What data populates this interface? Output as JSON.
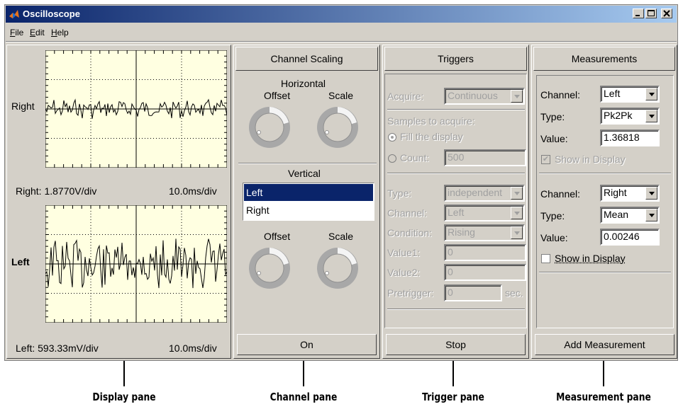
{
  "window": {
    "title": "Oscilloscope"
  },
  "menu": [
    "File",
    "Edit",
    "Help"
  ],
  "display": {
    "right": {
      "name": "Right",
      "vdiv": "Right: 1.8770V/div",
      "tdiv": "10.0ms/div"
    },
    "left": {
      "name": "Left",
      "vdiv": "Left: 593.33mV/div",
      "tdiv": "10.0ms/div"
    }
  },
  "channel": {
    "header": "Channel Scaling",
    "horizontal": "Horizontal",
    "offset": "Offset",
    "scale": "Scale",
    "vertical": "Vertical",
    "list": [
      "Left",
      "Right"
    ],
    "selected": "Left",
    "button": "On"
  },
  "triggers": {
    "header": "Triggers",
    "acquire_label": "Acquire:",
    "acquire_value": "Continuous",
    "samples_label": "Samples to acquire:",
    "fill_label": "Fill the display",
    "count_label": "Count:",
    "count_value": "500",
    "type_label": "Type:",
    "type_value": "independent",
    "channel_label": "Channel:",
    "channel_value": "Left",
    "condition_label": "Condition:",
    "condition_value": "Rising",
    "value1_label": "Value1:",
    "value1": "0",
    "value2_label": "Value2:",
    "value2": "0",
    "pretrigger_label": "Pretrigger:",
    "pretrigger": "0",
    "sec": "sec.",
    "button": "Stop"
  },
  "measurements": {
    "header": "Measurements",
    "channel_label": "Channel:",
    "type_label": "Type:",
    "value_label": "Value:",
    "show_label": "Show in Display",
    "m1": {
      "channel": "Left",
      "type": "Pk2Pk",
      "value": "1.36818",
      "show": true
    },
    "m2": {
      "channel": "Right",
      "type": "Mean",
      "value": "0.00246",
      "show": false
    },
    "button": "Add Measurement"
  },
  "captions": {
    "display": "Display pane",
    "channel": "Channel pane",
    "trigger": "Trigger pane",
    "measurement": "Measurement pane"
  }
}
